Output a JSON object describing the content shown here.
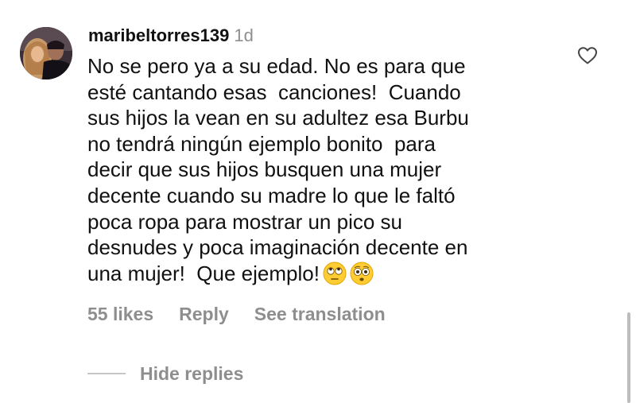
{
  "comment": {
    "username": "maribeltorres139",
    "timestamp": "1d",
    "lines": [
      "No se pero ya a su edad. No es para que",
      "esté cantando esas  canciones!  Cuando",
      "sus hijos la vean en su adultez esa Burbu",
      "no tendrá ningún ejemplo bonito  para",
      "decir que sus hijos busquen una mujer",
      "decente cuando su madre lo que le faltó",
      "poca ropa para mostrar un pico su",
      "desnudes y poca imaginación decente en",
      "una mujer!  Que ejemplo!"
    ],
    "emojis": [
      "face-with-rolling-eyes-emoji",
      "flushed-face-emoji"
    ]
  },
  "actions": {
    "likes": "55 likes",
    "reply": "Reply",
    "see_translation": "See translation"
  },
  "replies": {
    "hide_label": "Hide replies"
  },
  "icons": {
    "like": "heart-outline-icon"
  },
  "colors": {
    "text": "#111111",
    "muted": "#8e8e8e",
    "emoji_yellow": "#ffcc33"
  }
}
